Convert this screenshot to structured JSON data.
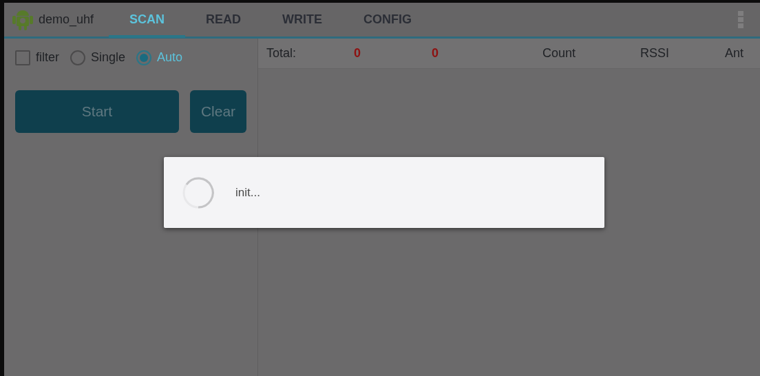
{
  "app": {
    "title": "demo_uhf"
  },
  "tabs": [
    {
      "label": "SCAN",
      "selected": true
    },
    {
      "label": "READ",
      "selected": false
    },
    {
      "label": "WRITE",
      "selected": false
    },
    {
      "label": "CONFIG",
      "selected": false
    }
  ],
  "options": [
    {
      "kind": "checkbox",
      "label": "filter",
      "checked": false
    },
    {
      "kind": "radio",
      "label": "Single",
      "selected": false
    },
    {
      "kind": "radio",
      "label": "Auto",
      "selected": true
    }
  ],
  "buttons": [
    "Start",
    "Clear"
  ],
  "table": {
    "total_label": "Total:",
    "counts": [
      "0",
      "0"
    ],
    "columns": [
      "Count",
      "RSSI",
      "Ant"
    ]
  },
  "dialog": {
    "message": "init..."
  }
}
